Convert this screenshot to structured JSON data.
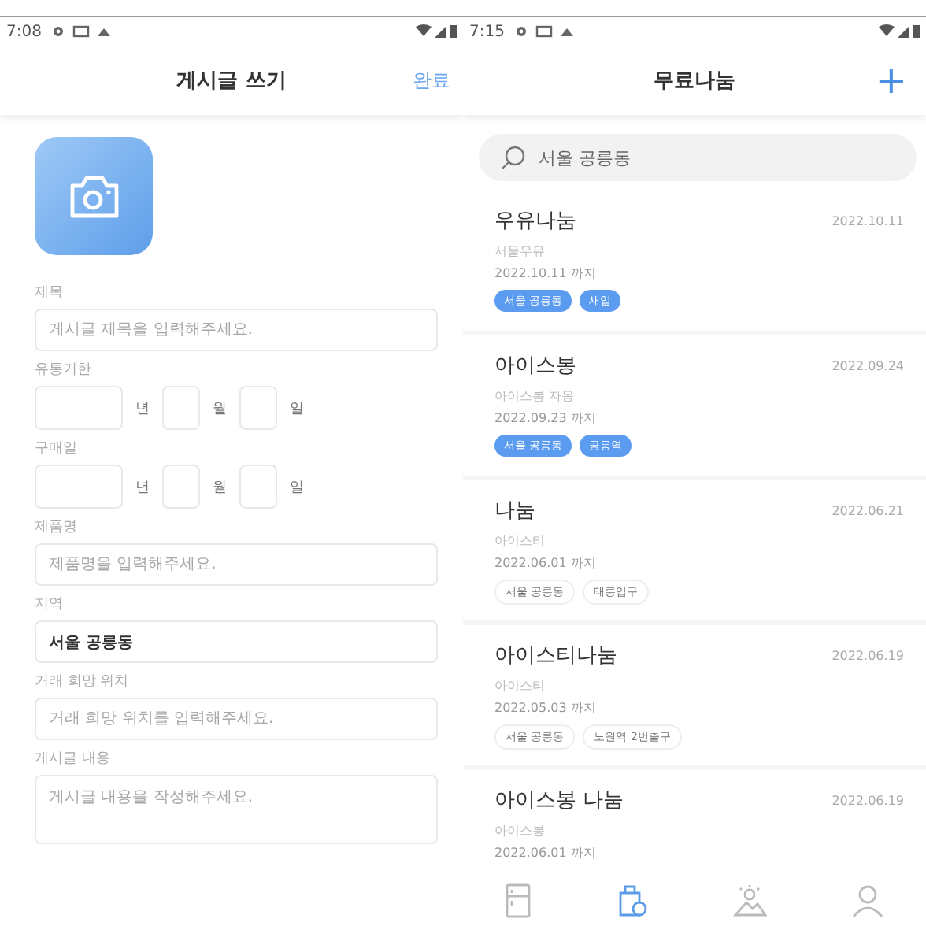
{
  "left_screen": {
    "status_bar": {
      "time": "7:08"
    },
    "title": "게시글 쓰기",
    "done_button": "완료",
    "fields": [
      {
        "kind": "text",
        "label": "제목",
        "placeholder": "게시글 제목을 입력해주세요."
      },
      {
        "kind": "date",
        "label": "유통기한",
        "units": [
          "년",
          "월",
          "일"
        ]
      },
      {
        "kind": "date",
        "label": "구매일",
        "units": [
          "년",
          "월",
          "일"
        ]
      },
      {
        "kind": "text",
        "label": "제품명",
        "placeholder": "제품명을 입력해주세요."
      },
      {
        "kind": "text",
        "label": "지역",
        "value": "서울 공릉동"
      },
      {
        "kind": "text",
        "label": "거래 희망 위치",
        "placeholder": "거래 희망 위치를 입력해주세요."
      },
      {
        "kind": "area",
        "label": "게시글 내용",
        "placeholder": "게시글 내용을 작성해주세요."
      }
    ]
  },
  "right_screen": {
    "status_bar": {
      "time": "7:15"
    },
    "title": "무료나눔",
    "add_button": "+",
    "search": {
      "value": "서울 공릉동"
    },
    "posts": [
      {
        "title": "우유나눔",
        "subtitle": "서울우유",
        "date": "2022.10.11",
        "until": "2022.10.11 까지",
        "tags": [
          {
            "text": "서울 공릉동",
            "filled": true
          },
          {
            "text": "새입",
            "filled": true
          }
        ]
      },
      {
        "title": "아이스봉",
        "subtitle": "아이스봉 자몽",
        "date": "2022.09.24",
        "until": "2022.09.23 까지",
        "tags": [
          {
            "text": "서울 공릉동",
            "filled": true
          },
          {
            "text": "공릉역",
            "filled": true
          }
        ]
      },
      {
        "title": "나눔",
        "subtitle": "아이스티",
        "date": "2022.06.21",
        "until": "2022.06.01 까지",
        "tags": [
          {
            "text": "서울 공릉동",
            "filled": false
          },
          {
            "text": "태릉입구",
            "filled": false
          }
        ]
      },
      {
        "title": "아이스티나눔",
        "subtitle": "아이스티",
        "date": "2022.06.19",
        "until": "2022.05.03 까지",
        "tags": [
          {
            "text": "서울 공릉동",
            "filled": false
          },
          {
            "text": "노원역 2번출구",
            "filled": false
          }
        ]
      },
      {
        "title": "아이스봉 나눔",
        "subtitle": "아이스봉",
        "date": "2022.06.19",
        "until": "2022.06.01 까지"
      }
    ],
    "nav": [
      {
        "kind": "fridge",
        "selected": false
      },
      {
        "kind": "share",
        "selected": true
      },
      {
        "kind": "scene",
        "selected": false
      },
      {
        "kind": "profile",
        "selected": false
      }
    ]
  }
}
